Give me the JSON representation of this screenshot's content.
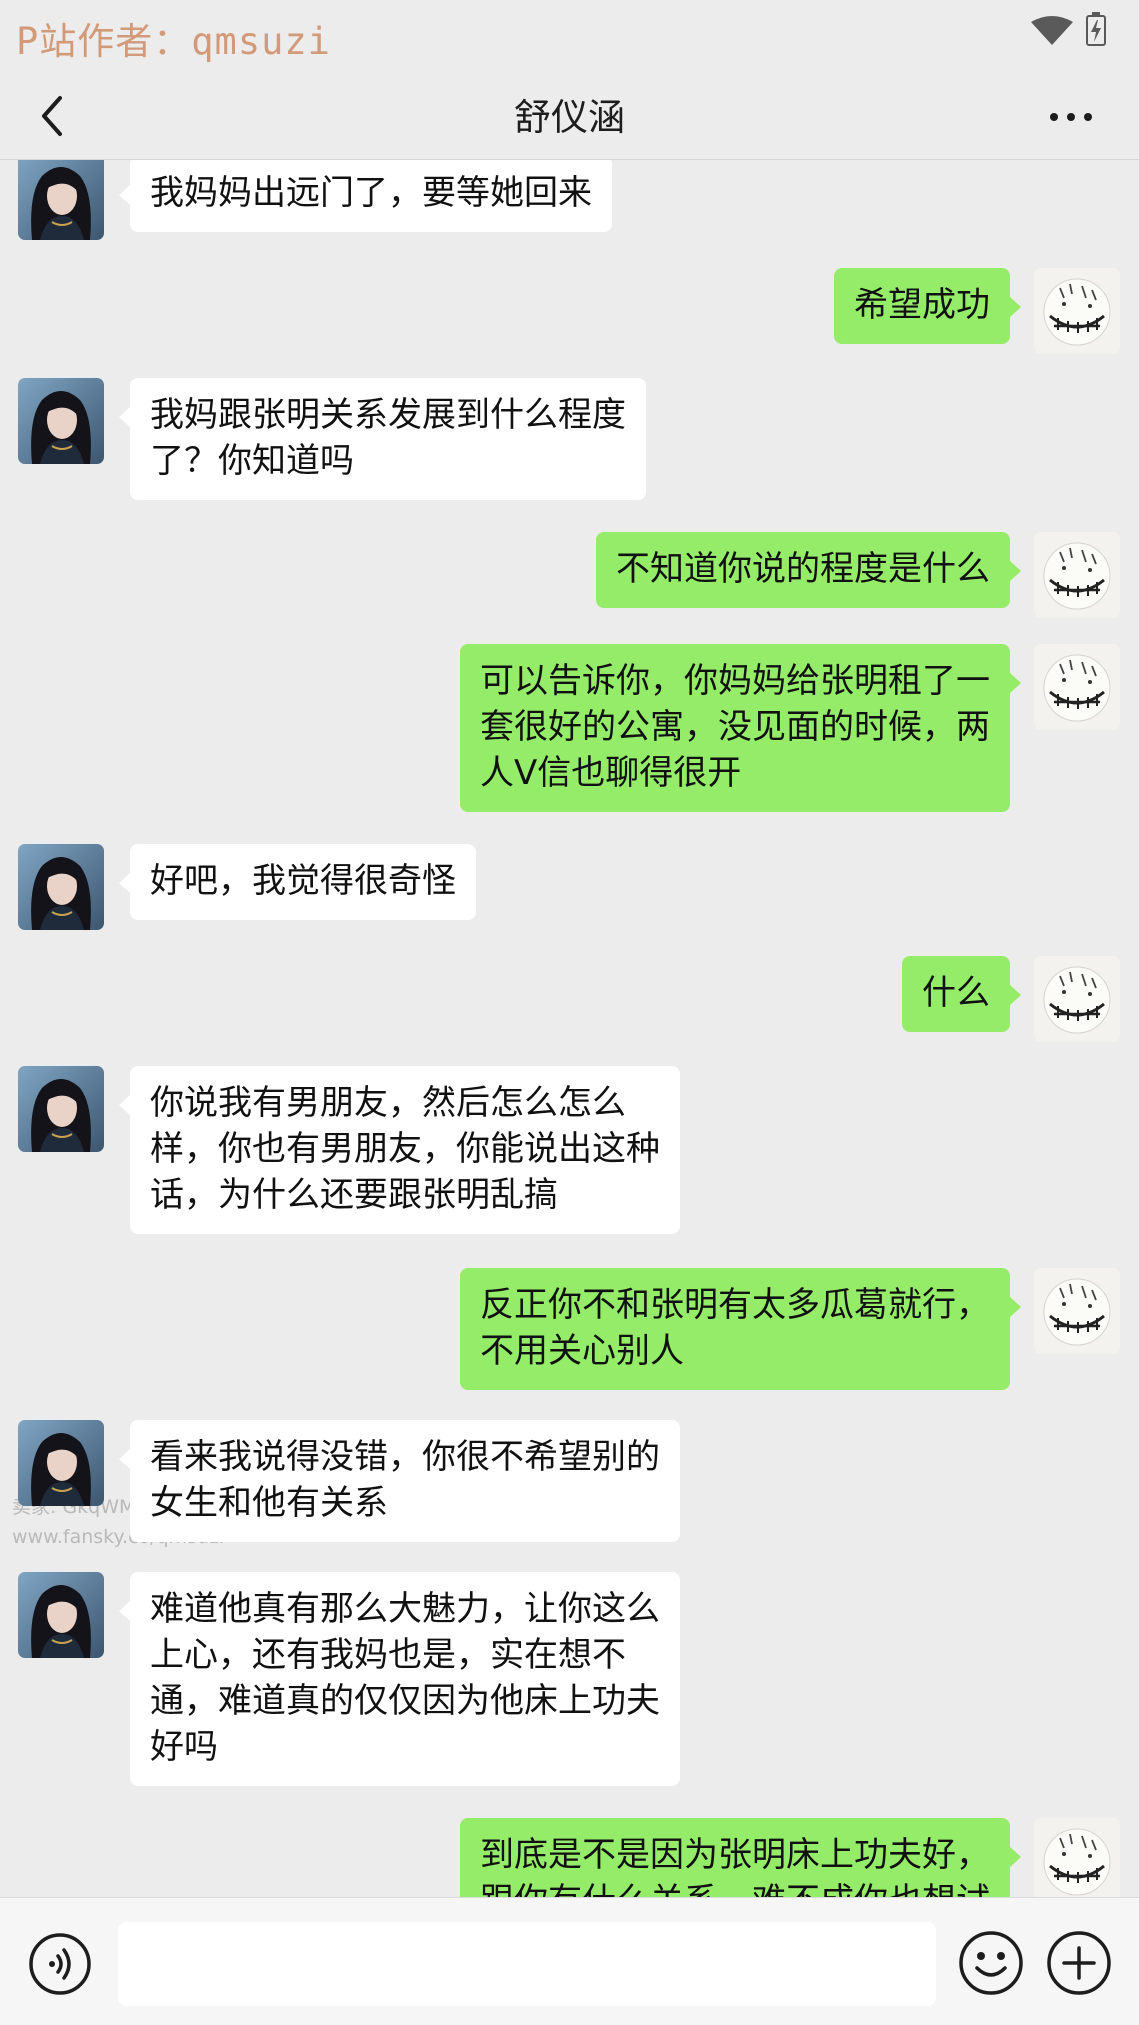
{
  "status_bar": {
    "watermark": "P站作者：qmsuzi",
    "icons": [
      "wifi-icon",
      "battery-icon"
    ]
  },
  "header": {
    "title": "舒仪涵",
    "icons": [
      "back-arrow-icon",
      "more-options-icon"
    ]
  },
  "messages": [
    {
      "side": "left",
      "text": "我妈妈出远门了，要等她回来"
    },
    {
      "side": "right",
      "text": "希望成功"
    },
    {
      "side": "left",
      "text": "我妈跟张明关系发展到什么程度\n了？你知道吗"
    },
    {
      "side": "right",
      "text": "不知道你说的程度是什么"
    },
    {
      "side": "right",
      "text": "可以告诉你，你妈妈给张明租了一\n套很好的公寓，没见面的时候，两\n人V信也聊得很开"
    },
    {
      "side": "left",
      "text": "好吧，我觉得很奇怪"
    },
    {
      "side": "right",
      "text": "什么"
    },
    {
      "side": "left",
      "text": "你说我有男朋友，然后怎么怎么\n样，你也有男朋友，你能说出这种\n话，为什么还要跟张明乱搞"
    },
    {
      "side": "right",
      "text": "反正你不和张明有太多瓜葛就行，\n不用关心别人"
    },
    {
      "side": "left",
      "text": "看来我说得没错，你很不希望别的\n女生和他有关系"
    },
    {
      "side": "left",
      "text": "难道他真有那么大魅力，让你这么\n上心，还有我妈也是，实在想不\n通，难道真的仅仅因为他床上功夫\n好吗"
    },
    {
      "side": "right",
      "text": "到底是不是因为张明床上功夫好，\n跟你有什么关系，难不成你也想试"
    }
  ],
  "overlay_watermark": {
    "line1": "卖家: GkqWM",
    "line2": "www.fansky.co/qmsuzi"
  },
  "input_bar": {
    "value": "",
    "icons": [
      "voice-icon",
      "emoji-icon",
      "plus-icon"
    ]
  },
  "colors": {
    "background": "#ececec",
    "sent_bubble": "#95ec69",
    "received_bubble": "#ffffff",
    "watermark": "#d29a78"
  }
}
